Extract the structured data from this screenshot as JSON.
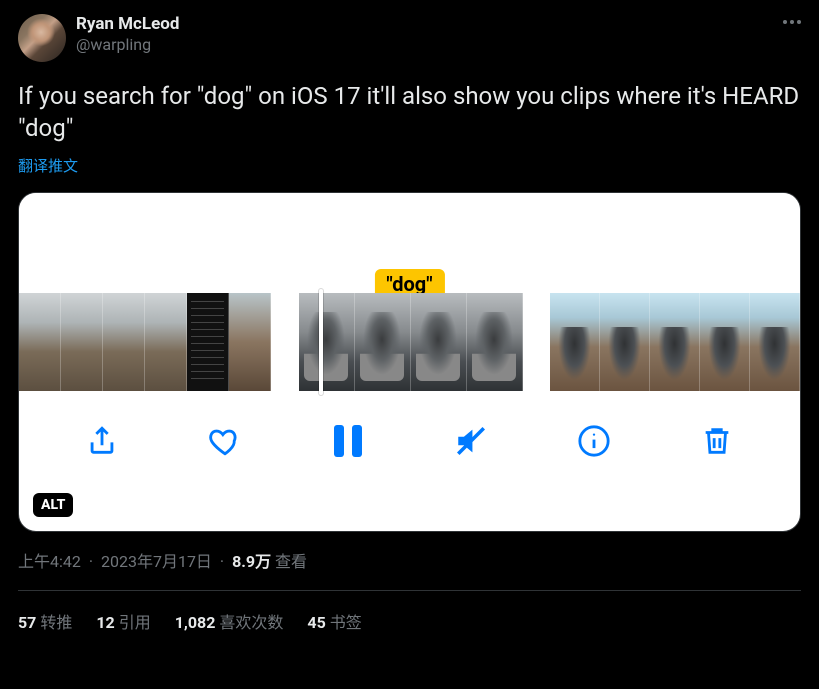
{
  "author": {
    "display_name": "Ryan McLeod",
    "handle": "@warpling"
  },
  "tweet_text": "If you search for \"dog\" on iOS 17 it'll also show you clips where it's HEARD \"dog\"",
  "translate_label": "翻译推文",
  "media": {
    "caption_label": "\"dog\"",
    "alt_badge": "ALT",
    "toolbar_icons": [
      "share-icon",
      "heart-icon",
      "pause-icon",
      "mute-icon",
      "info-icon",
      "trash-icon"
    ]
  },
  "meta": {
    "time": "上午4:42",
    "date": "2023年7月17日",
    "views_count": "8.9万",
    "views_label": "查看"
  },
  "stats": {
    "retweets_count": "57",
    "retweets_label": "转推",
    "quotes_count": "12",
    "quotes_label": "引用",
    "likes_count": "1,082",
    "likes_label": "喜欢次数",
    "bookmarks_count": "45",
    "bookmarks_label": "书签"
  }
}
